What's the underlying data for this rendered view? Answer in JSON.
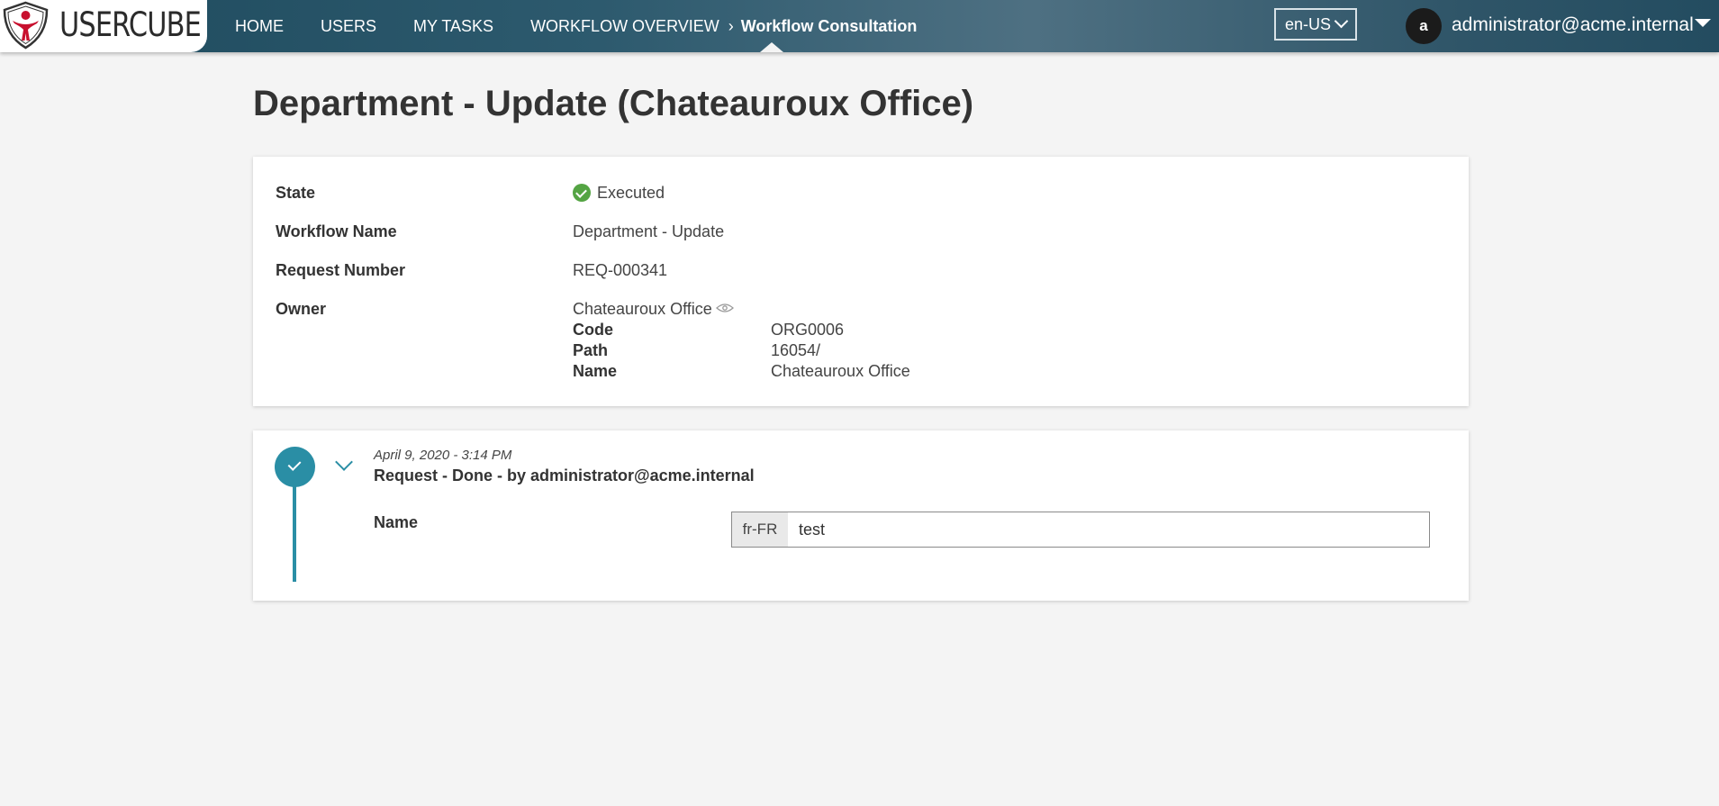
{
  "app": {
    "logo_text": "USERCUBE",
    "brand_color": "#c8102e"
  },
  "nav": {
    "items": [
      {
        "label": "HOME"
      },
      {
        "label": "USERS"
      },
      {
        "label": "MY TASKS"
      },
      {
        "label": "WORKFLOW OVERVIEW"
      }
    ],
    "current": "Workflow Consultation",
    "separator_icon": "chevron-right-icon"
  },
  "header": {
    "language": "en-US",
    "avatar_initial": "a",
    "user": "administrator@acme.internal"
  },
  "page": {
    "title": "Department - Update (Chateauroux Office)"
  },
  "details": {
    "state_label": "State",
    "state_value": "Executed",
    "state_icon": "check-circle-icon",
    "state_color": "#54a443",
    "workflow_name_label": "Workflow Name",
    "workflow_name_value": "Department - Update",
    "request_number_label": "Request Number",
    "request_number_value": "REQ-000341",
    "owner_label": "Owner",
    "owner_value": "Chateauroux Office",
    "owner_icon": "eye-icon",
    "owner_fields": {
      "code_label": "Code",
      "code_value": "ORG0006",
      "path_label": "Path",
      "path_value": "16054/",
      "name_label": "Name",
      "name_value": "Chateauroux Office"
    }
  },
  "timeline": {
    "accent_color": "#2a8ea5",
    "entries": [
      {
        "date": "April 9, 2020  - 3:14 PM",
        "title": "Request - Done - by administrator@acme.internal",
        "field_label": "Name",
        "field_locale": "fr-FR",
        "field_value": "test"
      }
    ]
  }
}
